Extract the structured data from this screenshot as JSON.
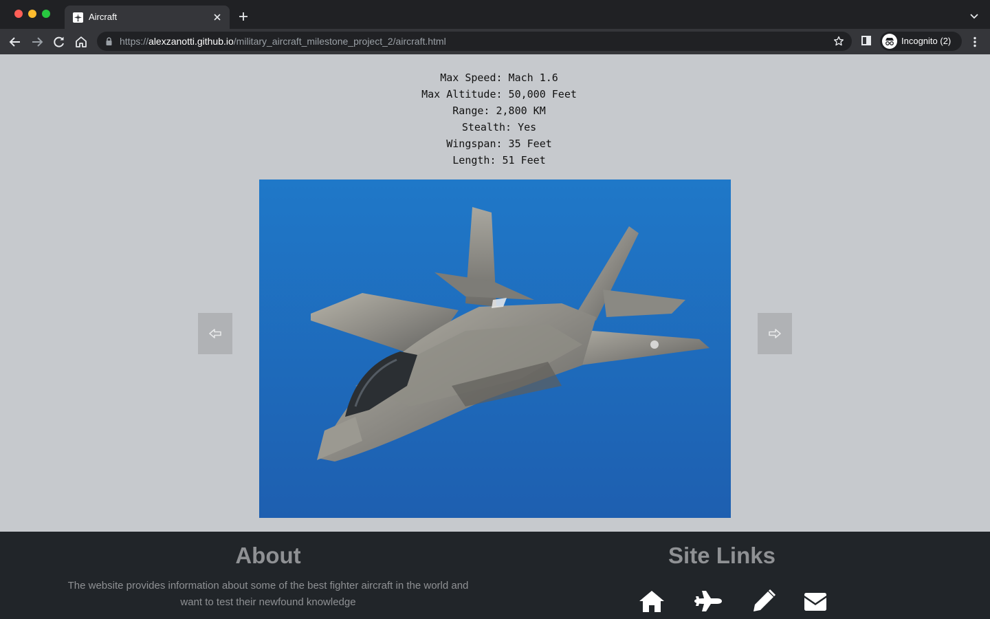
{
  "browser": {
    "tab_title": "Aircraft",
    "url_scheme": "https://",
    "url_host": "alexzanotti.github.io",
    "url_path": "/military_aircraft_milestone_project_2/aircraft.html",
    "profile_label": "Incognito (2)"
  },
  "aircraft": {
    "stats": [
      "Max Speed: Mach 1.6",
      "Max Altitude: 50,000 Feet",
      "Range: 2,800 KM",
      "Stealth: Yes",
      "Wingspan: 35 Feet",
      "Length: 51 Feet"
    ]
  },
  "footer": {
    "about_heading": "About",
    "about_text_line1": "The website provides information about some of the best fighter aircraft in the world and",
    "about_text_line2": "want to test their newfound knowledge",
    "links_heading": "Site Links",
    "link_icons": [
      "home-icon",
      "plane-icon",
      "pencil-icon",
      "envelope-icon"
    ]
  },
  "colors": {
    "page_bg": "#c6c9cd",
    "footer_bg": "#212529",
    "footer_text": "#8f9194",
    "sky_blue": "#1f6fc0"
  }
}
